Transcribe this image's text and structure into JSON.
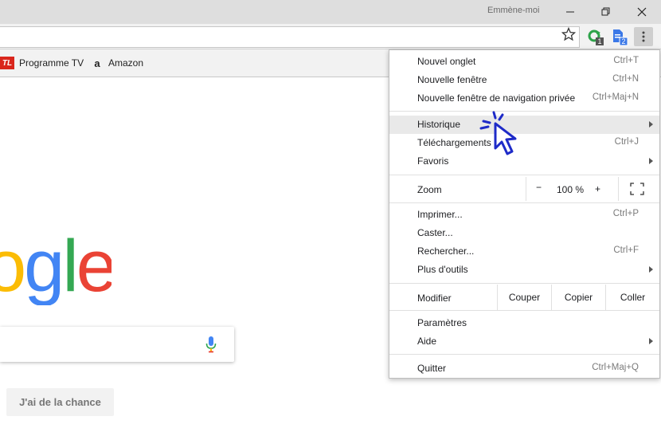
{
  "titlebar": {
    "profile_name": "Emmène-moi",
    "buttons": [
      "minimize-icon",
      "restore-icon",
      "close-icon"
    ]
  },
  "toolbar": {
    "extension_badges": [
      "1",
      "2"
    ]
  },
  "bookmarks": [
    {
      "label": "Programme TV",
      "icon_text": "TL"
    },
    {
      "label": "Amazon",
      "icon_text": "a"
    }
  ],
  "page": {
    "logo_text": "ogle",
    "lucky_button": "J'ai de la chance"
  },
  "menu": {
    "new_tab": {
      "label": "Nouvel onglet",
      "shortcut": "Ctrl+T"
    },
    "new_window": {
      "label": "Nouvelle fenêtre",
      "shortcut": "Ctrl+N"
    },
    "incognito": {
      "label": "Nouvelle fenêtre de navigation privée",
      "shortcut": "Ctrl+Maj+N"
    },
    "history": {
      "label": "Historique"
    },
    "downloads": {
      "label": "Téléchargements",
      "shortcut": "Ctrl+J"
    },
    "bookmarks": {
      "label": "Favoris"
    },
    "zoom": {
      "label": "Zoom",
      "minus": "−",
      "value": "100 %",
      "plus": "+"
    },
    "print": {
      "label": "Imprimer...",
      "shortcut": "Ctrl+P"
    },
    "cast": {
      "label": "Caster..."
    },
    "find": {
      "label": "Rechercher...",
      "shortcut": "Ctrl+F"
    },
    "more_tools": {
      "label": "Plus d'outils"
    },
    "edit": {
      "label": "Modifier",
      "cut": "Couper",
      "copy": "Copier",
      "paste": "Coller"
    },
    "settings": {
      "label": "Paramètres"
    },
    "help": {
      "label": "Aide"
    },
    "quit": {
      "label": "Quitter",
      "shortcut": "Ctrl+Maj+Q"
    }
  },
  "colors": {
    "google_blue": "#4285F4",
    "google_red": "#EA4335",
    "google_yellow": "#FBBC05",
    "google_green": "#34A853",
    "cursor": "#1e2bc8"
  }
}
